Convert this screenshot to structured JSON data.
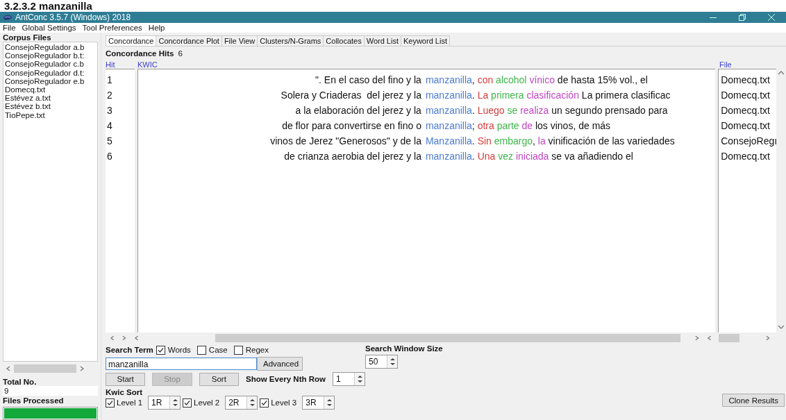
{
  "heading": "3.2.3.2 manzanilla",
  "window": {
    "title": "AntConc 3.5.7 (Windows) 2018"
  },
  "menu": [
    "File",
    "Global Settings",
    "Tool Preferences",
    "Help"
  ],
  "corpus_files": {
    "label": "Corpus Files",
    "items": [
      "ConsejoRegulador a.b",
      "ConsejoRegulador b.t:",
      "ConsejoRegulador c.b",
      "ConsejoRegulador d.t:",
      "ConsejoRegulador e.b",
      "Domecq.txt",
      "Estévez a.txt",
      "Estévez b.txt",
      "TioPepe.txt"
    ]
  },
  "total_no": {
    "label": "Total No.",
    "value": "9"
  },
  "files_processed": {
    "label": "Files Processed",
    "level": 1
  },
  "tabs": [
    {
      "label": "Concordance",
      "selected": true
    },
    {
      "label": "Concordance Plot",
      "selected": false
    },
    {
      "label": "File View",
      "selected": false
    },
    {
      "label": "Clusters/N-Grams",
      "selected": false
    },
    {
      "label": "Collocates",
      "selected": false
    },
    {
      "label": "Word List",
      "selected": false
    },
    {
      "label": "Keyword List",
      "selected": false
    }
  ],
  "concordance": {
    "hits_label": "Concordance Hits",
    "hits": "6",
    "columns": [
      "Hit",
      "KWIC",
      "File"
    ],
    "rows": [
      {
        "hit": "1",
        "left": "\". En el caso del fino y la",
        "keyword": "manzanilla",
        "after": ",",
        "collocates": [
          {
            "text": "con",
            "color": "#d63c3c"
          },
          {
            "text": "alcohol",
            "color": "#3db54a"
          },
          {
            "text": "vínico",
            "color": "#c044c4"
          }
        ],
        "rest": "de hasta 15% vol., el",
        "file": "Domecq.txt"
      },
      {
        "hit": "2",
        "left": "Solera y Criaderas  del jerez y la",
        "keyword": "manzanilla",
        "after": ".",
        "collocates": [
          {
            "text": "La",
            "color": "#d63c3c"
          },
          {
            "text": "primera",
            "color": "#3db54a"
          },
          {
            "text": "clasificación",
            "color": "#c044c4"
          }
        ],
        "rest": "La primera clasificac",
        "file": "Domecq.txt"
      },
      {
        "hit": "3",
        "left": "a la elaboración del jerez y la",
        "keyword": "manzanilla",
        "after": ".",
        "collocates": [
          {
            "text": "Luego",
            "color": "#d63c3c"
          },
          {
            "text": "se",
            "color": "#3db54a"
          },
          {
            "text": "realiza",
            "color": "#c044c4"
          }
        ],
        "rest": "un segundo prensado para",
        "file": "Domecq.txt"
      },
      {
        "hit": "4",
        "left": "de flor para convertirse en fino o",
        "keyword": "manzanilla",
        "after": ";",
        "collocates": [
          {
            "text": "otra",
            "color": "#d63c3c"
          },
          {
            "text": "parte",
            "color": "#3db54a"
          },
          {
            "text": "de",
            "color": "#c044c4"
          }
        ],
        "rest": "los vinos, de más",
        "file": "Domecq.txt"
      },
      {
        "hit": "5",
        "left": "vinos de Jerez \"Generosos\" y de la",
        "keyword": "Manzanilla",
        "after": ".",
        "collocates": [
          {
            "text": "Sin",
            "color": "#d63c3c"
          },
          {
            "text": "embargo",
            "color": "#3db54a",
            "after": ","
          },
          {
            "text": "la",
            "color": "#c044c4"
          }
        ],
        "rest": "vinificación de las variedades",
        "file": "ConsejoRegı"
      },
      {
        "hit": "6",
        "left": "de crianza aerobia del jerez y la",
        "keyword": "manzanilla",
        "after": ".",
        "collocates": [
          {
            "text": "Una",
            "color": "#d63c3c"
          },
          {
            "text": "vez",
            "color": "#3db54a"
          },
          {
            "text": "iniciada",
            "color": "#c044c4"
          }
        ],
        "rest": "se va añadiendo el",
        "file": "Domecq.txt"
      }
    ]
  },
  "search": {
    "label": "Search Term",
    "options": [
      {
        "label": "Words",
        "checked": true
      },
      {
        "label": "Case",
        "checked": false
      },
      {
        "label": "Regex",
        "checked": false
      }
    ],
    "value": "manzanilla",
    "advanced": "Advanced",
    "buttons": [
      {
        "label": "Start",
        "disabled": false
      },
      {
        "label": "Stop",
        "disabled": true
      },
      {
        "label": "Sort",
        "disabled": false
      }
    ]
  },
  "nth_row": {
    "label": "Show Every Nth Row",
    "value": "1"
  },
  "window_size": {
    "label": "Search Window Size",
    "value": "50"
  },
  "kwic_sort": {
    "label": "Kwic Sort",
    "levels": [
      {
        "label": "Level 1",
        "checked": true,
        "value": "1R"
      },
      {
        "label": "Level 2",
        "checked": true,
        "value": "2R"
      },
      {
        "label": "Level 3",
        "checked": true,
        "value": "3R"
      }
    ]
  },
  "clone_button": "Clone Results"
}
